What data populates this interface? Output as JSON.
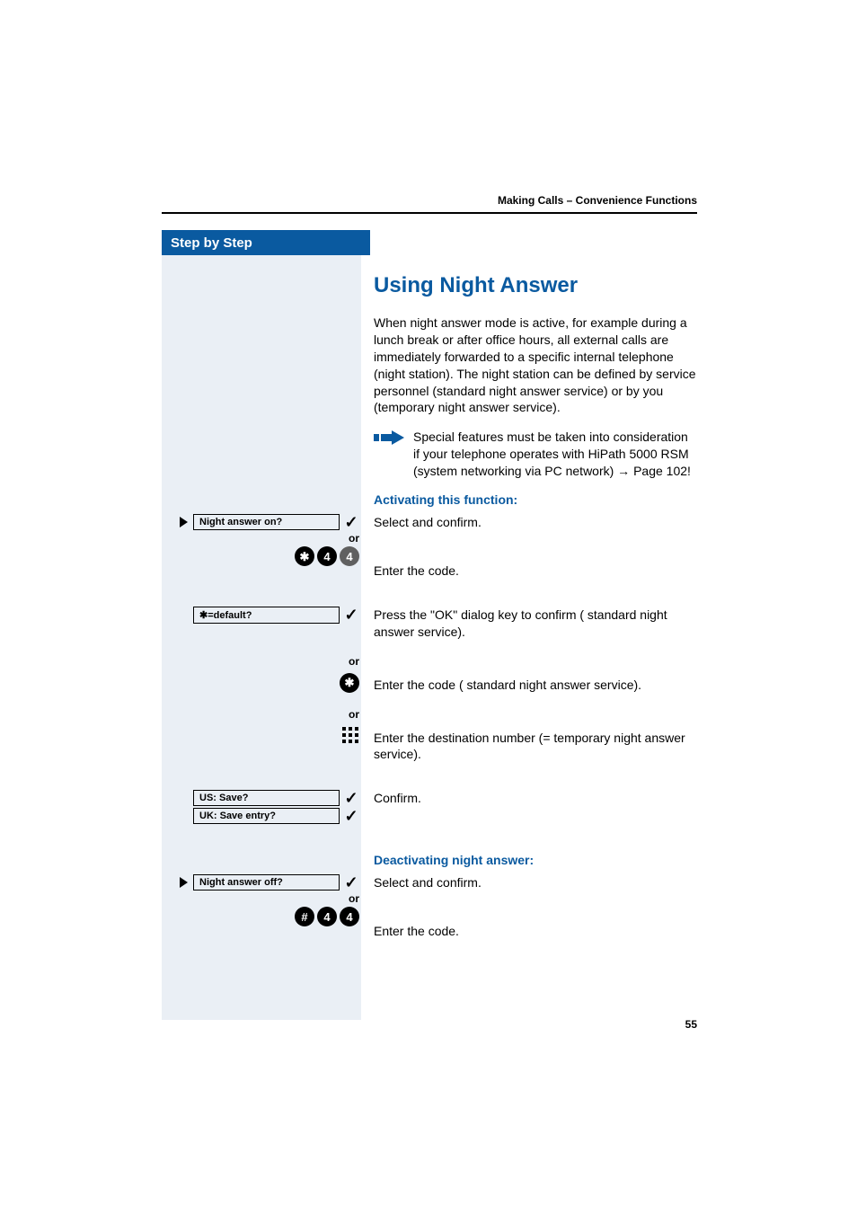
{
  "header": {
    "breadcrumb": "Making Calls – Convenience Functions"
  },
  "sidebar": {
    "title": "Step by Step"
  },
  "section": {
    "title": "Using Night Answer",
    "intro": "When night answer mode is active, for example during a lunch break or after office hours, all external calls are immediately forwarded to a specific internal telephone (night station). The night station can be defined by service personnel (standard night answer service) or by you (temporary night answer service).",
    "note": "Special features must be taken into consideration if your telephone operates with HiPath 5000 RSM (system networking via PC network) → Page 102!",
    "activate_heading": "Activating this function:",
    "deactivate_heading": "Deactivating night answer:",
    "or_label": "or"
  },
  "prompts": {
    "night_on": "Night answer on?",
    "default": "✱=default?",
    "save_us": "US: Save?",
    "save_uk": "UK: Save entry?",
    "night_off": "Night answer off?"
  },
  "keys": {
    "star": "✱",
    "hash": "#",
    "d4": "4"
  },
  "steps": {
    "select_confirm": "Select and confirm.",
    "enter_code": "Enter the code.",
    "press_ok_default": "Press the \"OK\" dialog key to confirm ( standard night answer service).",
    "enter_code_std": "Enter the code ( standard night answer service).",
    "enter_dest": "Enter the destination number (= temporary night answer service).",
    "confirm": "Confirm."
  },
  "page_number": "55"
}
